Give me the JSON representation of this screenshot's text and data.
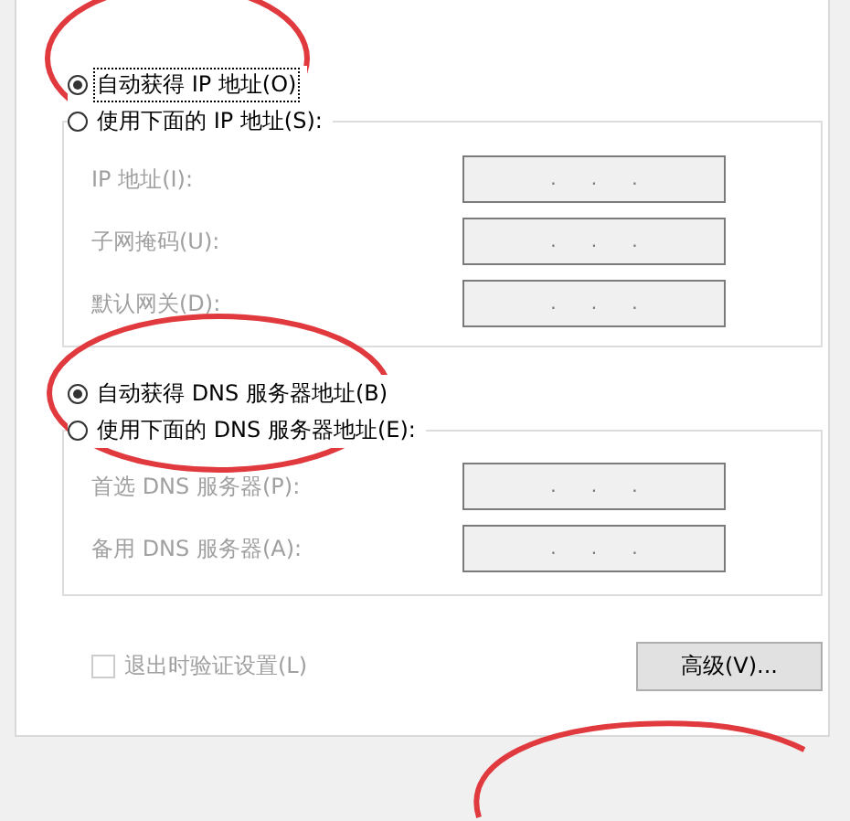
{
  "ip_mode": [
    {
      "label": "自动获得 IP 地址(O)",
      "selected": true,
      "focused": true
    },
    {
      "label": "使用下面的 IP 地址(S):",
      "selected": false,
      "focused": false
    }
  ],
  "ip_group": {
    "disabled": true,
    "fields": [
      {
        "label": "IP 地址(I):",
        "value": ".      .      ."
      },
      {
        "label": "子网掩码(U):",
        "value": ".      .      ."
      },
      {
        "label": "默认网关(D):",
        "value": ".      .      ."
      }
    ]
  },
  "dns_mode": [
    {
      "label": "自动获得 DNS 服务器地址(B)",
      "selected": true,
      "focused": false
    },
    {
      "label": "使用下面的 DNS 服务器地址(E):",
      "selected": false,
      "focused": false
    }
  ],
  "dns_group": {
    "disabled": true,
    "fields": [
      {
        "label": "首选 DNS 服务器(P):",
        "value": ".      .      ."
      },
      {
        "label": "备用 DNS 服务器(A):",
        "value": ".      .      ."
      }
    ]
  },
  "validate_checkbox": {
    "label": "退出时验证设置(L)",
    "checked": false,
    "disabled": true
  },
  "advanced_button": {
    "label": "高级(V)..."
  }
}
